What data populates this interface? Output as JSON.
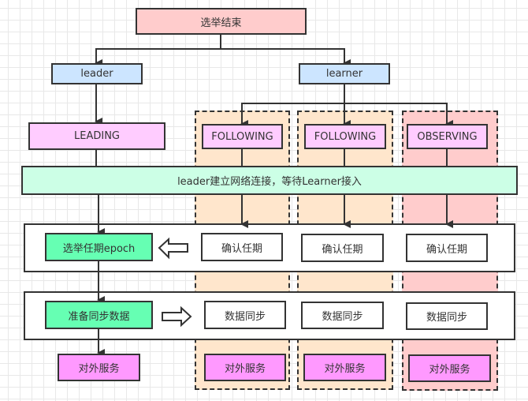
{
  "diagram": {
    "top": {
      "label": "选举结束"
    },
    "roles": {
      "leader": "leader",
      "learner": "learner"
    },
    "states": {
      "leading": "LEADING",
      "following1": "FOLLOWING",
      "following2": "FOLLOWING",
      "observing": "OBSERVING"
    },
    "connect_band": {
      "label": "leader建立网络连接，等待Learner接入"
    },
    "epoch_row": {
      "leader": "选举任期epoch",
      "follower1": "确认任期",
      "follower2": "确认任期",
      "observer": "确认任期"
    },
    "sync_row": {
      "leader": "准备同步数据",
      "follower1": "数据同步",
      "follower2": "数据同步",
      "observer": "数据同步"
    },
    "serve_row": {
      "leader": "对外服务",
      "follower1": "对外服务",
      "follower2": "对外服务",
      "observer": "对外服务"
    },
    "colors": {
      "top": "#ffcccc",
      "role": "#cce5ff",
      "state": "#ffccff",
      "band": "#ccffe6",
      "leader_step": "#66ffb3",
      "serve": "#ff99ff",
      "follower_lane": "#ffe6cc",
      "observer_lane": "#ffcccc"
    }
  }
}
